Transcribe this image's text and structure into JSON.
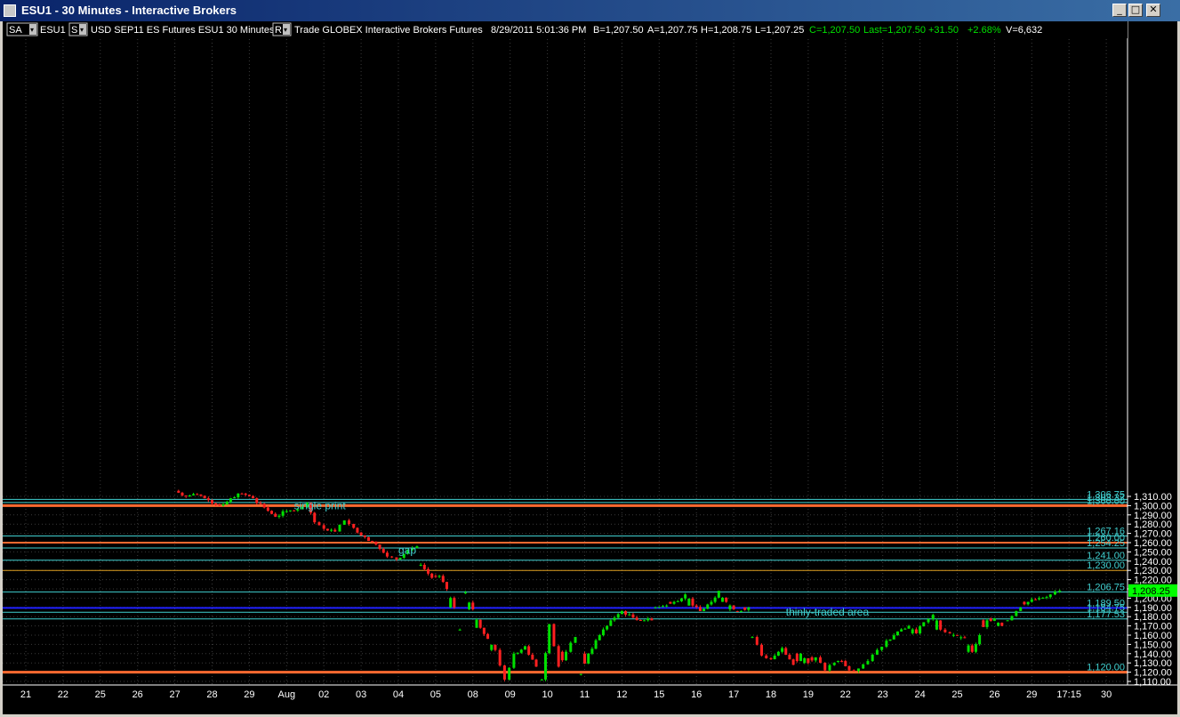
{
  "window": {
    "title": "ESU1 - 30 Minutes - Interactive Brokers",
    "buttons": [
      "_",
      "□",
      "✕"
    ]
  },
  "toolbar": {
    "account": "SA",
    "symbol": "ESU1",
    "s_box": "S",
    "description": "USD SEP11 ES Futures ESU1  30 Minutes",
    "r_box": "R",
    "source": "Trade  GLOBEX  Interactive Brokers  Futures",
    "datetime": "8/29/2011  5:01:36 PM",
    "bid": "B=1,207.50",
    "ask": "A=1,207.75",
    "high": "H=1,208.75",
    "low": "L=1,207.25",
    "close": "C=1,207.50",
    "last": "Last=1,207.50",
    "change": "+31.50",
    "pct_change": "+2.68%",
    "volume": "V=6,632"
  },
  "colors": {
    "background": "#000000",
    "up_bar": "#00e000",
    "down_bar": "#ff2020",
    "cyan_level": "#40d0d0",
    "orange_level": "#ff6a30",
    "gold_level": "#e0a020",
    "blue_level": "#2020ff",
    "grid": "#3a3a3a",
    "price_tag": "#00ff00"
  },
  "chart_data": {
    "type": "candlestick",
    "title": "",
    "xlabel": "",
    "ylabel": "",
    "ylim": [
      1110,
      1320
    ],
    "y_ticks": [
      1110,
      1120,
      1130,
      1140,
      1150,
      1160,
      1170,
      1180,
      1190,
      1200,
      1210,
      1220,
      1230,
      1240,
      1250,
      1260,
      1270,
      1280,
      1290,
      1300,
      1310
    ],
    "y_tick_labels": [
      "1,110.00",
      "1,120.00",
      "1,130.00",
      "1,140.00",
      "1,150.00",
      "1,160.00",
      "1,170.00",
      "1,180.00",
      "1,190.00",
      "1,200.00",
      "1,210.00",
      "1,220.00",
      "1,230.00",
      "1,240.00",
      "1,250.00",
      "1,260.00",
      "1,270.00",
      "1,280.00",
      "1,290.00",
      "1,300.00",
      "1,310.00"
    ],
    "x_ticks": [
      "21",
      "22",
      "25",
      "26",
      "27",
      "28",
      "29",
      "Aug",
      "02",
      "03",
      "04",
      "05",
      "08",
      "09",
      "10",
      "11",
      "12",
      "15",
      "16",
      "17",
      "18",
      "19",
      "22",
      "23",
      "24",
      "25",
      "26",
      "29",
      "17:15",
      "30"
    ],
    "levels": [
      {
        "value": 1306.75,
        "label": "1,306.75",
        "style": "cyan"
      },
      {
        "value": 1303.37,
        "label": "1,303.37",
        "style": "cyan"
      },
      {
        "value": 1300.0,
        "label": "1,300.00",
        "style": "orange-thick"
      },
      {
        "value": 1267.16,
        "label": "1,267.16",
        "style": "cyan"
      },
      {
        "value": 1260.0,
        "label": "1,260.00",
        "style": "orange"
      },
      {
        "value": 1254.25,
        "label": "1,254.25",
        "style": "cyan"
      },
      {
        "value": 1241.0,
        "label": "1,241.00",
        "style": "cyan"
      },
      {
        "value": 1230.0,
        "label": "1,230.00",
        "style": "gold"
      },
      {
        "value": 1206.75,
        "label": "1,206.75",
        "style": "cyan"
      },
      {
        "value": 1189.5,
        "label": "1,189.50",
        "style": "blue"
      },
      {
        "value": 1184.75,
        "label": "1,184.75",
        "style": "cyan"
      },
      {
        "value": 1177.53,
        "label": "1,177.53",
        "style": "cyan"
      },
      {
        "value": 1120.0,
        "label": "1,120.00",
        "style": "orange-thick"
      }
    ],
    "last_price": {
      "value": 1208.25,
      "label": "1,208.25"
    },
    "annotations": [
      {
        "text": "single print",
        "x_index": 7.2,
        "y": 1296
      },
      {
        "text": "gap",
        "x_index": 10.0,
        "y": 1248
      },
      {
        "text": "thinly-traded area",
        "x_index": 20.4,
        "y": 1181
      }
    ],
    "path": [
      [
        4.0,
        1316
      ],
      [
        4.3,
        1310
      ],
      [
        4.6,
        1312
      ],
      [
        4.9,
        1306
      ],
      [
        5.2,
        1300
      ],
      [
        5.5,
        1308
      ],
      [
        5.8,
        1313
      ],
      [
        6.1,
        1308
      ],
      [
        6.4,
        1298
      ],
      [
        6.7,
        1288
      ],
      [
        7.0,
        1294
      ],
      [
        7.3,
        1296
      ],
      [
        7.55,
        1303
      ],
      [
        7.75,
        1282
      ],
      [
        8.0,
        1275
      ],
      [
        8.3,
        1272
      ],
      [
        8.55,
        1284
      ],
      [
        8.8,
        1276
      ],
      [
        9.1,
        1266
      ],
      [
        9.4,
        1258
      ],
      [
        9.7,
        1245
      ],
      [
        9.95,
        1242
      ],
      [
        10.25,
        1252
      ],
      [
        10.5,
        1256
      ],
      [
        10.6,
        1236
      ],
      [
        10.9,
        1222
      ],
      [
        11.1,
        1224
      ],
      [
        11.3,
        1210
      ],
      [
        11.5,
        1190
      ],
      [
        11.65,
        1166
      ],
      [
        11.8,
        1206
      ],
      [
        12.0,
        1188
      ],
      [
        12.2,
        1168
      ],
      [
        12.4,
        1156
      ],
      [
        12.6,
        1144
      ],
      [
        12.85,
        1112
      ],
      [
        13.1,
        1140
      ],
      [
        13.4,
        1148
      ],
      [
        13.7,
        1126
      ],
      [
        13.85,
        1112
      ],
      [
        14.05,
        1172
      ],
      [
        14.3,
        1126
      ],
      [
        14.5,
        1142
      ],
      [
        14.75,
        1158
      ],
      [
        14.9,
        1118
      ],
      [
        15.1,
        1140
      ],
      [
        15.4,
        1160
      ],
      [
        15.7,
        1176
      ],
      [
        16.0,
        1186
      ],
      [
        16.3,
        1179
      ],
      [
        16.6,
        1176
      ],
      [
        16.8,
        1176
      ],
      [
        16.9,
        1190
      ],
      [
        17.2,
        1192
      ],
      [
        17.4,
        1196
      ],
      [
        17.7,
        1204
      ],
      [
        17.9,
        1192
      ],
      [
        18.1,
        1186
      ],
      [
        18.4,
        1196
      ],
      [
        18.6,
        1208
      ],
      [
        18.8,
        1196
      ],
      [
        19.0,
        1188
      ],
      [
        19.2,
        1186
      ],
      [
        19.4,
        1190
      ],
      [
        19.5,
        1158
      ],
      [
        19.75,
        1138
      ],
      [
        20.0,
        1134
      ],
      [
        20.3,
        1146
      ],
      [
        20.6,
        1128
      ],
      [
        20.8,
        1140
      ],
      [
        21.0,
        1130
      ],
      [
        21.2,
        1136
      ],
      [
        21.45,
        1122
      ],
      [
        21.7,
        1130
      ],
      [
        21.9,
        1132
      ],
      [
        22.1,
        1122
      ],
      [
        22.35,
        1124
      ],
      [
        22.6,
        1132
      ],
      [
        22.85,
        1144
      ],
      [
        23.1,
        1154
      ],
      [
        23.4,
        1164
      ],
      [
        23.7,
        1170
      ],
      [
        23.9,
        1162
      ],
      [
        24.1,
        1174
      ],
      [
        24.35,
        1182
      ],
      [
        24.55,
        1166
      ],
      [
        24.8,
        1162
      ],
      [
        25.0,
        1160
      ],
      [
        25.2,
        1157
      ],
      [
        25.4,
        1142
      ],
      [
        25.6,
        1160
      ],
      [
        25.8,
        1176
      ],
      [
        26.0,
        1178
      ],
      [
        26.2,
        1170
      ],
      [
        26.35,
        1176
      ],
      [
        26.7,
        1190
      ],
      [
        26.9,
        1196
      ],
      [
        27.2,
        1200
      ],
      [
        27.5,
        1204
      ],
      [
        27.75,
        1208
      ]
    ]
  }
}
